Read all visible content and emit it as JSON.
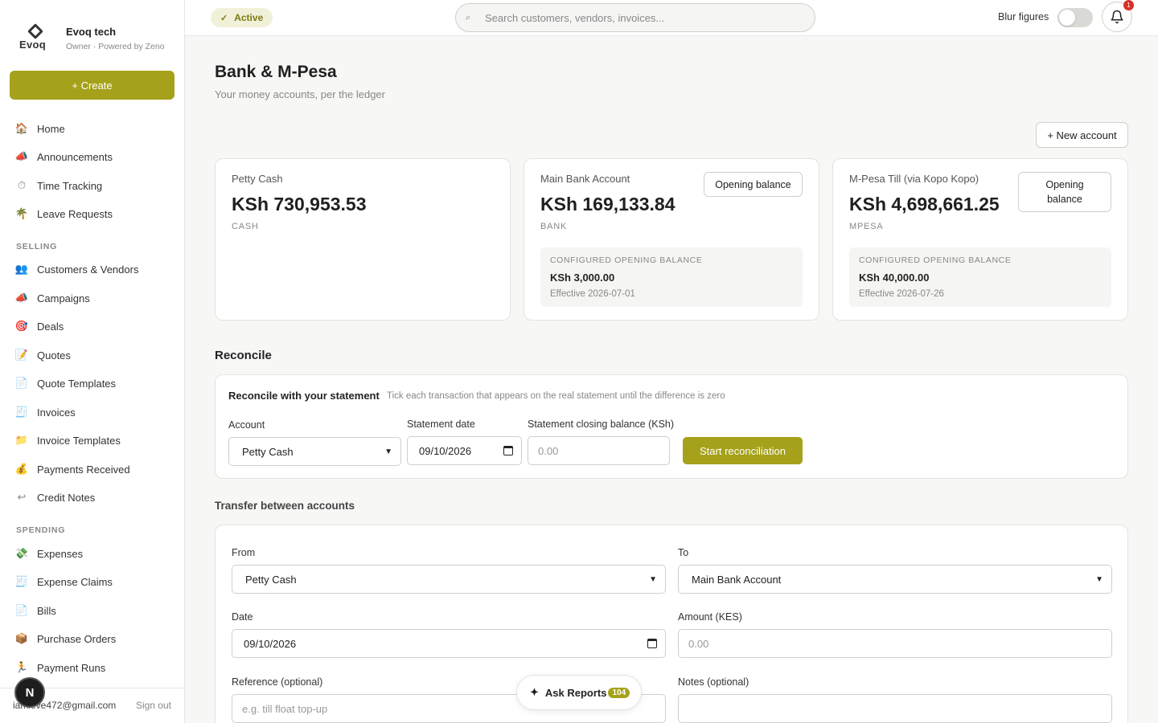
{
  "brand": {
    "logo_word": "Evoq",
    "name": "Evoq tech",
    "subtitle": "Owner · Powered by Zeno"
  },
  "sidebar": {
    "create_label": "+ Create",
    "main_items": [
      {
        "label": "Home",
        "icon": "house-icon"
      },
      {
        "label": "Announcements",
        "icon": "megaphone-icon"
      },
      {
        "label": "Time Tracking",
        "icon": "stopwatch-icon"
      },
      {
        "label": "Leave Requests",
        "icon": "palm-tree-icon"
      }
    ],
    "selling_heading": "SELLING",
    "selling_items": [
      {
        "label": "Customers & Vendors",
        "icon": "people-icon"
      },
      {
        "label": "Campaigns",
        "icon": "megaphone-icon"
      },
      {
        "label": "Deals",
        "icon": "target-icon"
      },
      {
        "label": "Quotes",
        "icon": "memo-icon"
      },
      {
        "label": "Quote Templates",
        "icon": "page-icon"
      },
      {
        "label": "Invoices",
        "icon": "receipt-icon"
      },
      {
        "label": "Invoice Templates",
        "icon": "folder-icon"
      },
      {
        "label": "Payments Received",
        "icon": "money-bag-icon"
      },
      {
        "label": "Credit Notes",
        "icon": "return-icon"
      }
    ],
    "spending_heading": "SPENDING",
    "spending_items": [
      {
        "label": "Expenses",
        "icon": "money-wings-icon"
      },
      {
        "label": "Expense Claims",
        "icon": "receipt-icon"
      },
      {
        "label": "Bills",
        "icon": "page-icon"
      },
      {
        "label": "Purchase Orders",
        "icon": "package-icon"
      },
      {
        "label": "Payment Runs",
        "icon": "runner-icon"
      }
    ],
    "user_email": "iamleve472@gmail.com",
    "signout_label": "Sign out",
    "avatar_letter": "N"
  },
  "topbar": {
    "status_label": "Active",
    "search_placeholder": "Search customers, vendors, invoices...",
    "blur_label": "Blur figures",
    "blur_enabled": false,
    "notification_count": "1"
  },
  "page": {
    "title": "Bank & M-Pesa",
    "subtitle": "Your money accounts, per the ledger",
    "new_account_label": "+ New account"
  },
  "accounts": [
    {
      "name": "Petty Cash",
      "balance": "KSh 730,953.53",
      "type": "CASH"
    },
    {
      "name": "Main Bank Account",
      "balance": "KSh 169,133.84",
      "type": "BANK",
      "opening_btn": "Opening balance",
      "ob_label": "CONFIGURED OPENING BALANCE",
      "ob_value": "KSh 3,000.00",
      "ob_effective": "Effective 2026-07-01"
    },
    {
      "name": "M-Pesa Till (via Kopo Kopo)",
      "balance": "KSh 4,698,661.25",
      "type": "MPESA",
      "opening_btn": "Opening balance",
      "ob_label": "CONFIGURED OPENING BALANCE",
      "ob_value": "KSh 40,000.00",
      "ob_effective": "Effective 2026-07-26"
    }
  ],
  "reconcile": {
    "heading": "Reconcile",
    "title": "Reconcile with your statement",
    "hint": "Tick each transaction that appears on the real statement until the difference is zero",
    "account_label": "Account",
    "account_value": "Petty Cash",
    "date_label": "Statement date",
    "date_value": "09/10/2026",
    "closing_label": "Statement closing balance (KSh)",
    "closing_placeholder": "0.00",
    "start_label": "Start reconciliation"
  },
  "transfer": {
    "heading": "Transfer between accounts",
    "from_label": "From",
    "from_value": "Petty Cash",
    "to_label": "To",
    "to_value": "Main Bank Account",
    "date_label": "Date",
    "date_value": "09/10/2026",
    "amount_label": "Amount (KES)",
    "amount_placeholder": "0.00",
    "reference_label": "Reference (optional)",
    "reference_placeholder": "e.g. till float top-up",
    "notes_label": "Notes (optional)"
  },
  "ask_reports": {
    "label": "Ask Reports",
    "count": "104"
  },
  "colors": {
    "accent": "#a5a11a",
    "badge_bg": "#f1f0d8",
    "alert": "#d93025"
  }
}
